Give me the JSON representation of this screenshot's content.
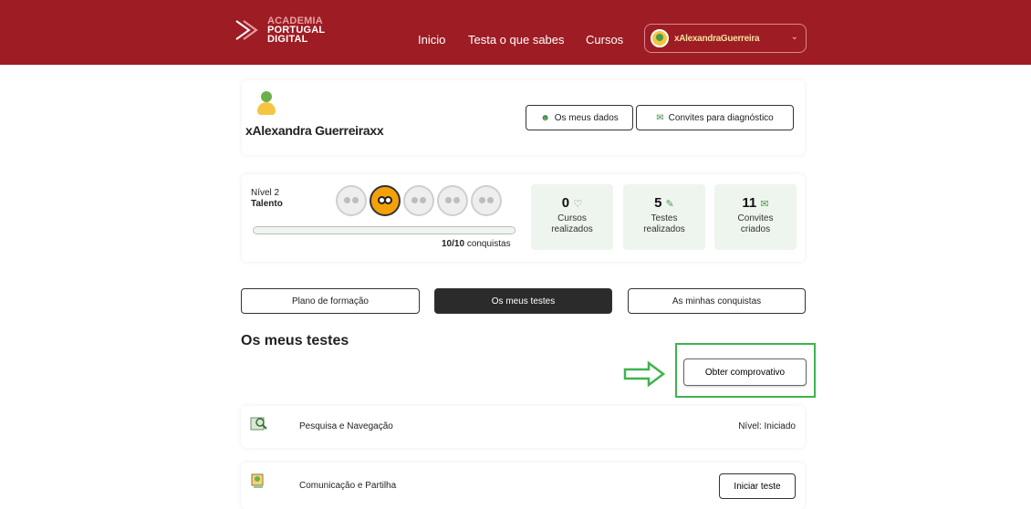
{
  "header": {
    "logo": {
      "line1": "ACADEMIA",
      "line2": "PORTUGAL",
      "line3": "DIGITAL"
    },
    "nav": [
      {
        "label": "Inicio"
      },
      {
        "label": "Testa o que sabes"
      },
      {
        "label": "Cursos"
      }
    ],
    "user": {
      "name": "xAlexandraGuerreira"
    },
    "brand_color": "#9e1c23"
  },
  "profile": {
    "name": "xAlexandra Guerreiraxx",
    "buttons": {
      "dados": "Os meus dados",
      "convites": "Convites para diagnóstico"
    }
  },
  "level": {
    "nivel": "Nível 2",
    "title": "Talento",
    "progress_fraction": 1.0,
    "conquistas_count": "10/10",
    "conquistas_label": "conquistas"
  },
  "stats": [
    {
      "value": "0",
      "icon": "graduation-cap-icon",
      "label_line1": "Cursos",
      "label_line2": "realizados"
    },
    {
      "value": "5",
      "icon": "pencil-icon",
      "label_line1": "Testes",
      "label_line2": "realizados"
    },
    {
      "value": "11",
      "icon": "envelope-icon",
      "label_line1": "Convites",
      "label_line2": "criados"
    }
  ],
  "tabs": [
    {
      "label": "Plano de formação",
      "active": false
    },
    {
      "label": "Os meus testes",
      "active": true
    },
    {
      "label": "As minhas conquistas",
      "active": false
    }
  ],
  "section": {
    "title": "Os meus testes",
    "comprovativo_button": "Obter comprovativo",
    "highlight_color": "#3fb34f"
  },
  "tests": [
    {
      "name": "Pesquisa e Navegação",
      "status": "Nível: Iniciado",
      "icon": "search-map-icon"
    },
    {
      "name": "Comunicação e Partilha",
      "action": "Iniciar teste",
      "icon": "communication-icon"
    }
  ]
}
